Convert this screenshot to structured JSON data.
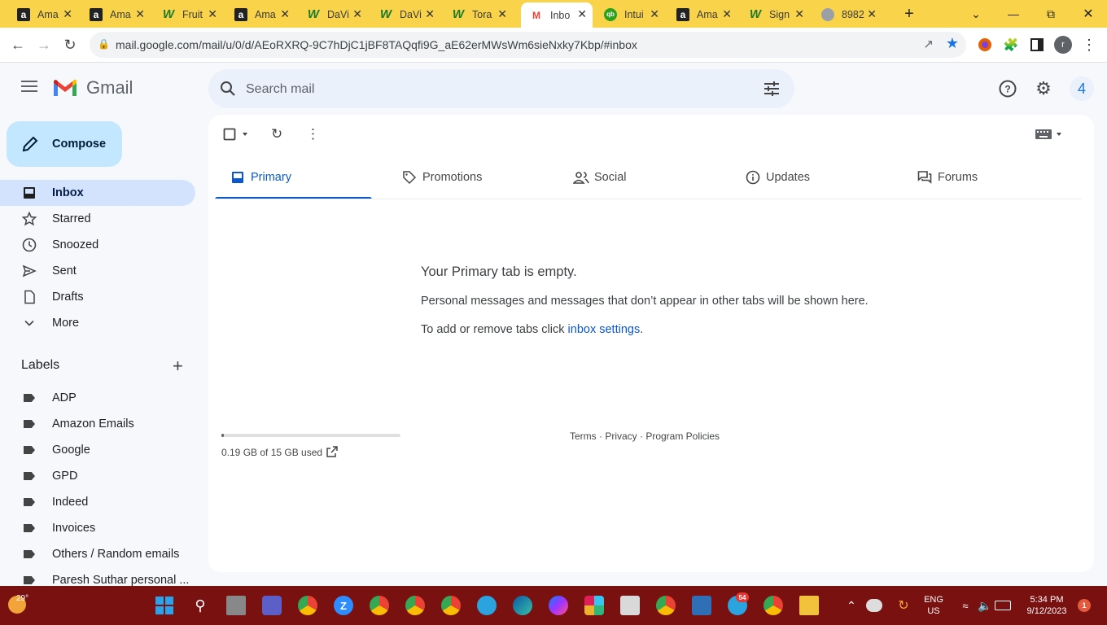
{
  "browser": {
    "tabs": [
      {
        "title": "Ama",
        "favicon": "amazon-icon",
        "active": false
      },
      {
        "title": "Ama",
        "favicon": "amazon-icon",
        "active": false
      },
      {
        "title": "Fruit",
        "favicon": "w-logo-icon",
        "active": false
      },
      {
        "title": "Ama",
        "favicon": "amazon-icon",
        "active": false
      },
      {
        "title": "DaVi",
        "favicon": "w-logo-icon",
        "active": false
      },
      {
        "title": "DaVi",
        "favicon": "w-logo-icon",
        "active": false
      },
      {
        "title": "Tora",
        "favicon": "w-logo-icon",
        "active": false
      },
      {
        "title": "Inbo",
        "favicon": "gmail-icon",
        "active": true
      },
      {
        "title": "Intui",
        "favicon": "quickbooks-icon",
        "active": false
      },
      {
        "title": "Ama",
        "favicon": "amazon-icon",
        "active": false
      },
      {
        "title": "Sign",
        "favicon": "w-logo-icon",
        "active": false
      },
      {
        "title": "8982",
        "favicon": "globe-icon",
        "active": false
      }
    ],
    "url": "mail.google.com/mail/u/0/d/AEoRXRQ-9C7hDjC1jBF8TAQqfi9G_aE62erMWsWm6sieNxky7Kbp/#inbox",
    "profile_initial": "r"
  },
  "gmail": {
    "logo_text": "Gmail",
    "search_placeholder": "Search mail",
    "account_initial": "4",
    "compose_label": "Compose",
    "nav": [
      {
        "label": "Inbox",
        "icon": "inbox-icon",
        "active": true
      },
      {
        "label": "Starred",
        "icon": "star-icon",
        "active": false
      },
      {
        "label": "Snoozed",
        "icon": "clock-icon",
        "active": false
      },
      {
        "label": "Sent",
        "icon": "send-icon",
        "active": false
      },
      {
        "label": "Drafts",
        "icon": "draft-icon",
        "active": false
      },
      {
        "label": "More",
        "icon": "chevron-down-icon",
        "active": false
      }
    ],
    "labels_heading": "Labels",
    "labels": [
      "ADP",
      "Amazon Emails",
      "Google",
      "GPD",
      "Indeed",
      "Invoices",
      "Others / Random emails",
      "Paresh Suthar personal ..."
    ],
    "category_tabs": [
      {
        "label": "Primary",
        "icon": "inbox-icon",
        "active": true
      },
      {
        "label": "Promotions",
        "icon": "tag-icon",
        "active": false
      },
      {
        "label": "Social",
        "icon": "people-icon",
        "active": false
      },
      {
        "label": "Updates",
        "icon": "info-icon",
        "active": false
      },
      {
        "label": "Forums",
        "icon": "forum-icon",
        "active": false
      }
    ],
    "empty_title": "Your Primary tab is empty.",
    "empty_line1": "Personal messages and messages that don’t appear in other tabs will be shown here.",
    "empty_line2_prefix": "To add or remove tabs click ",
    "empty_line2_link": "inbox settings",
    "empty_line2_suffix": ".",
    "storage_text": "0.19 GB of 15 GB used",
    "storage_fraction": 0.0127,
    "footer": "Terms · Privacy · Program Policies"
  },
  "taskbar": {
    "weather": "29°",
    "language_line1": "ENG",
    "language_line2": "US",
    "time": "5:34 PM",
    "date": "9/12/2023",
    "notification_count": "1",
    "telegram_badge": "54"
  },
  "colors": {
    "tab_strip": "#f9d44a",
    "accent": "#0b57d0",
    "compose_bg": "#c2e7ff",
    "active_nav_bg": "#d3e3fd",
    "taskbar": "#7a1111"
  }
}
